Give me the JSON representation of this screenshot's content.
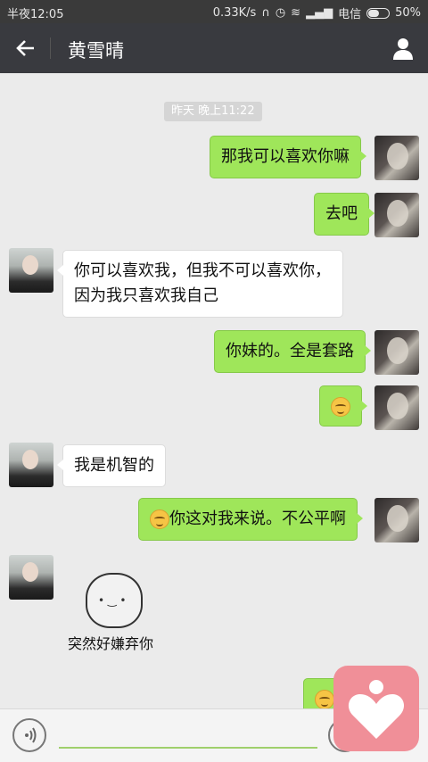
{
  "status_bar": {
    "time": "半夜12:05",
    "speed": "0.33K/s",
    "carrier": "电信",
    "battery": "50%",
    "battery_level": 0.5
  },
  "header": {
    "title": "黄雪晴"
  },
  "chat": {
    "timestamp": "昨天 晚上11:22",
    "messages": [
      {
        "sender": "me",
        "text": "那我可以喜欢你嘛"
      },
      {
        "sender": "me",
        "text": "去吧"
      },
      {
        "sender": "her",
        "text": "你可以喜欢我，但我不可以喜欢你，因为我只喜欢我自己"
      },
      {
        "sender": "me",
        "text": "你妹的。全是套路"
      },
      {
        "sender": "me",
        "emoji": "smile-emoji"
      },
      {
        "sender": "her",
        "text": "我是机智的"
      },
      {
        "sender": "me",
        "text": "你这对我来说。不公平啊",
        "emoji": "smile-emoji"
      },
      {
        "sender": "her",
        "sticker_caption": "突然好嫌弃你"
      },
      {
        "sender": "me",
        "emoji": "smile-emoji"
      }
    ]
  },
  "icons": {
    "back": "arrow-left-icon",
    "profile": "person-icon",
    "voice": "voice-icon",
    "heart": "heart-icon"
  }
}
